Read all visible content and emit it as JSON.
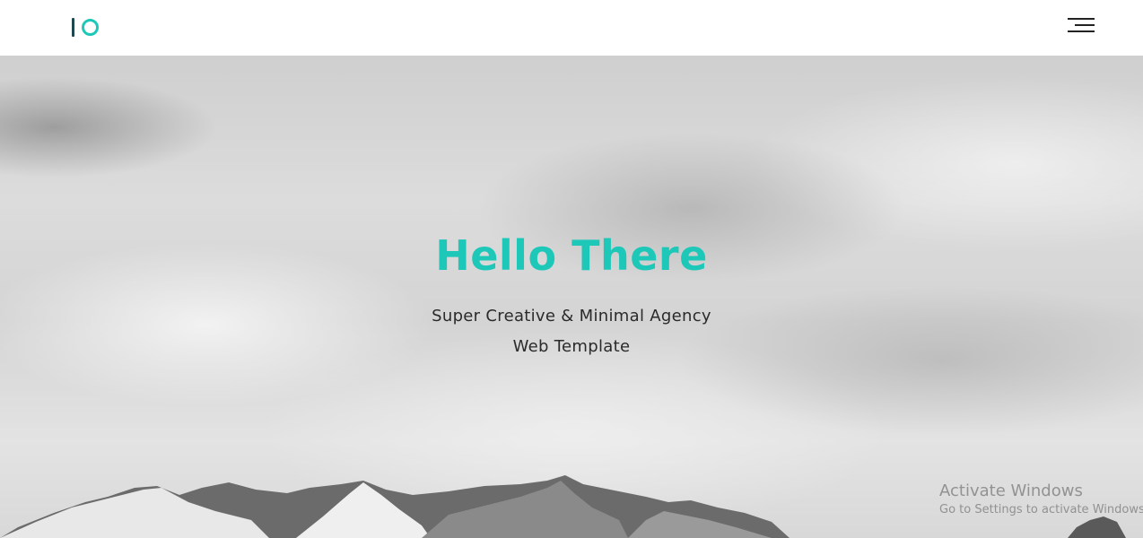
{
  "header": {
    "menu_icon": "hamburger-menu-icon",
    "logo_colors": {
      "bar": "#1f4750",
      "ring": "#1ec8b9"
    }
  },
  "hero": {
    "title": "Hello There",
    "subtitle_line1": "Super Creative & Minimal Agency",
    "subtitle_line2": "Web Template",
    "accent_color": "#1ec8b9"
  },
  "watermark": {
    "title": "Activate Windows",
    "subtitle": "Go to Settings to activate Windows."
  }
}
